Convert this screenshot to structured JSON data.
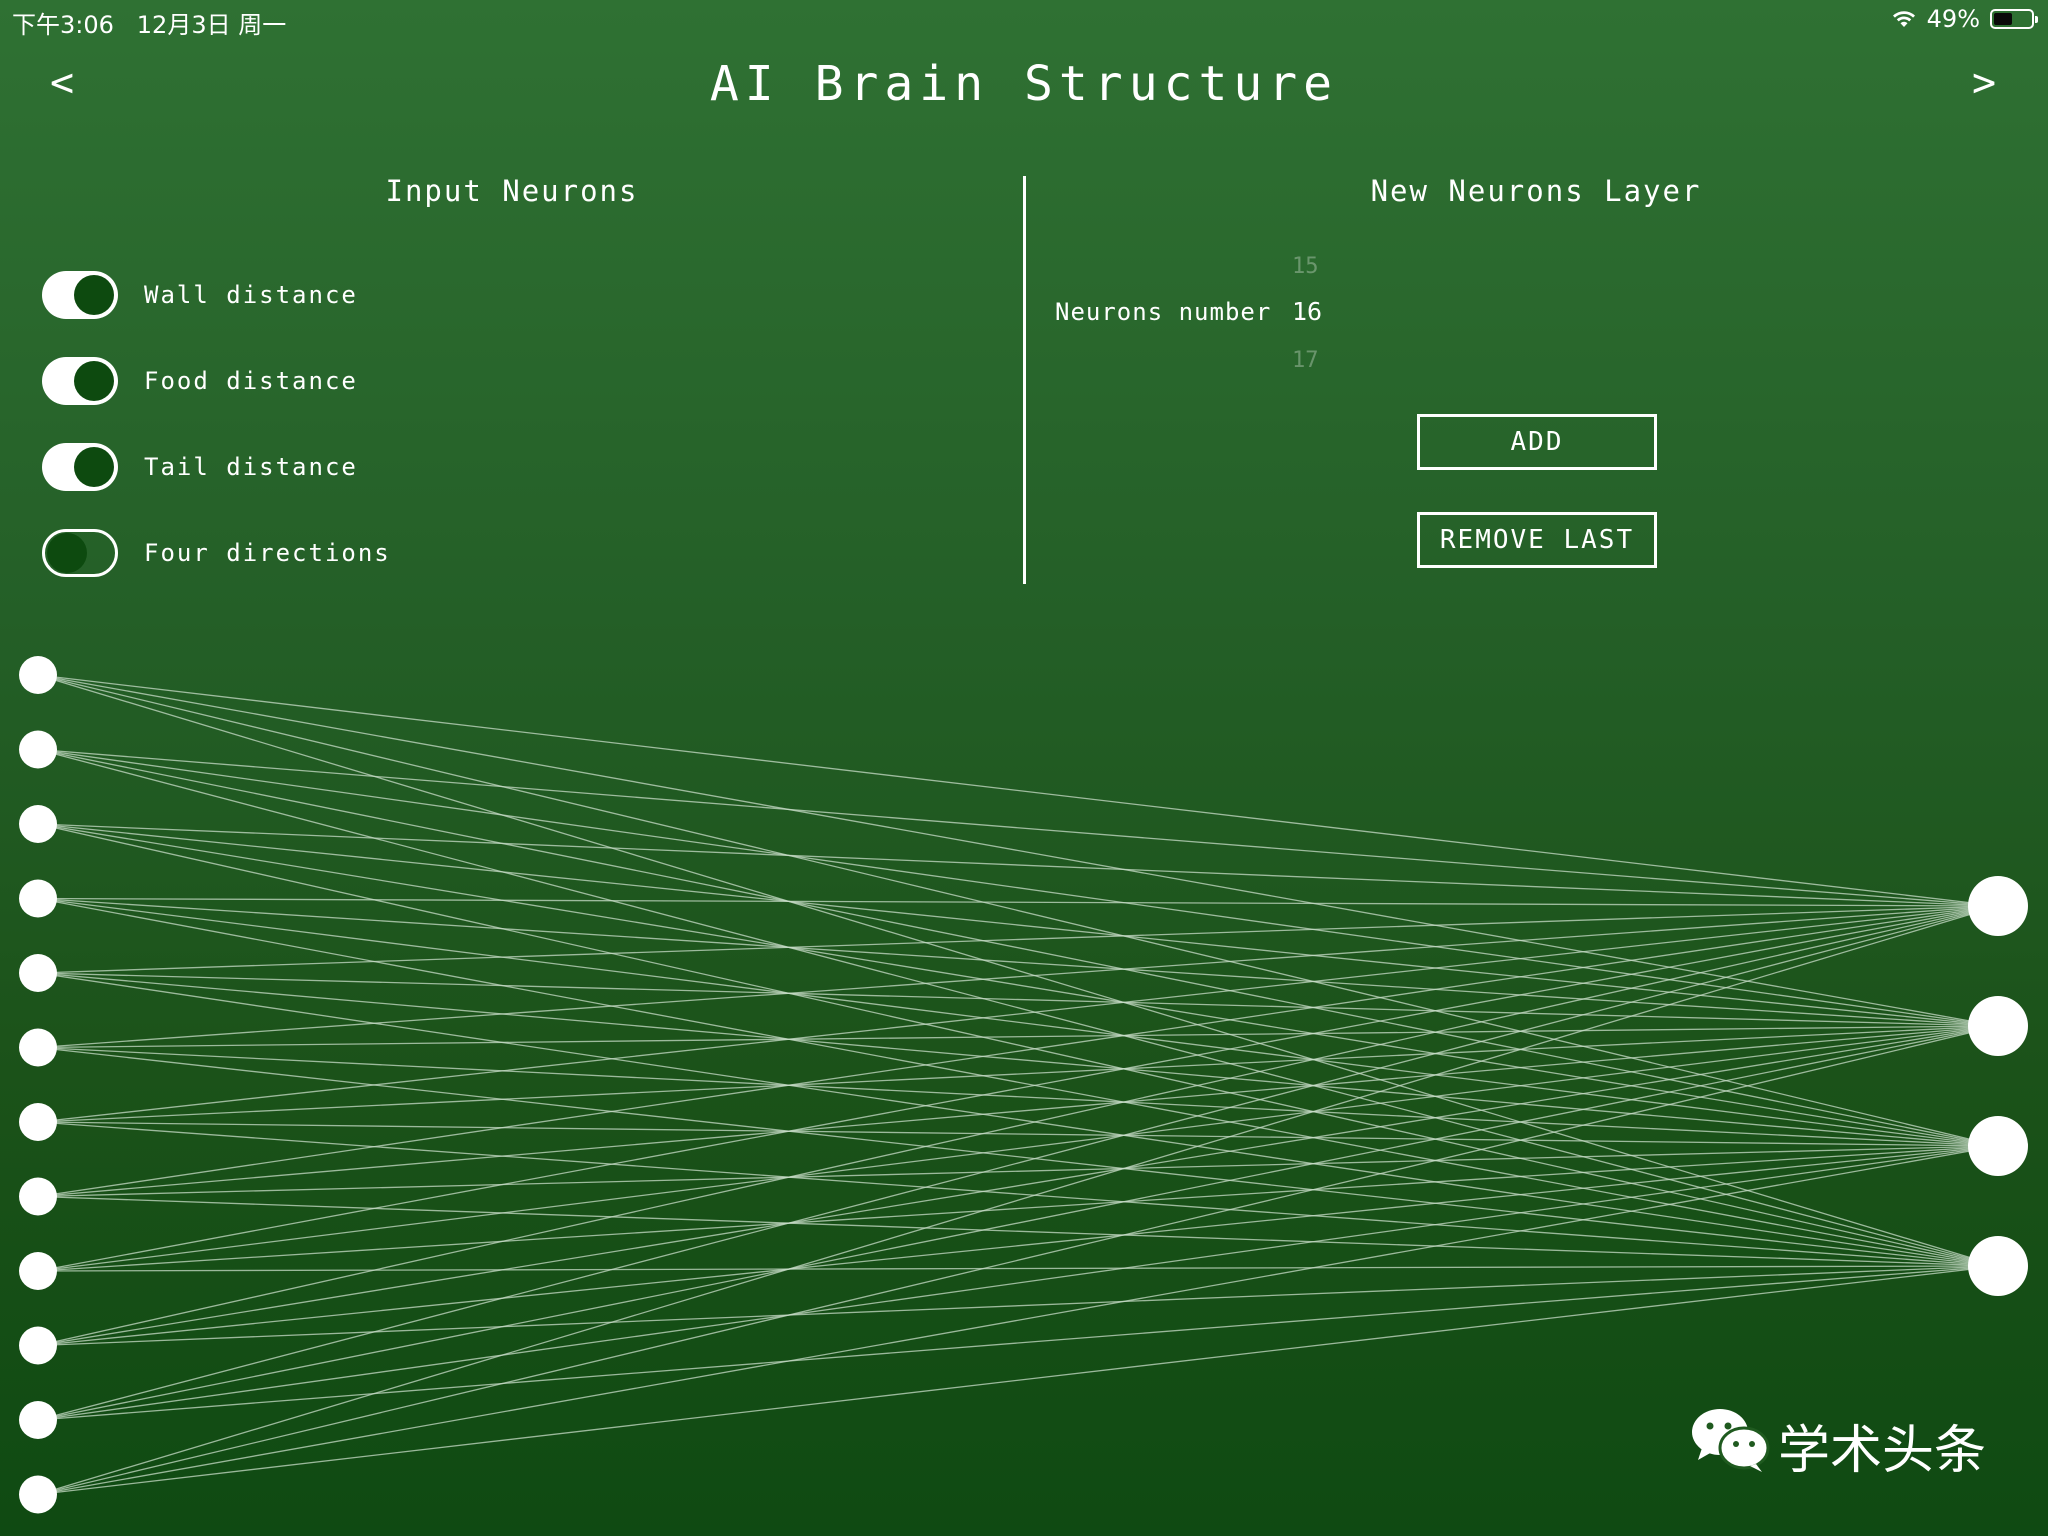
{
  "status_bar": {
    "time_date": "下午3:06   12月3日 周一",
    "battery_percent": "49%",
    "battery_level": 0.49,
    "icons": [
      "wifi-icon",
      "battery-icon"
    ]
  },
  "header": {
    "back_label": "<",
    "title": "AI Brain Structure",
    "forward_label": ">"
  },
  "input_neurons": {
    "title": "Input Neurons",
    "toggles": [
      {
        "label": "Wall distance",
        "on": true
      },
      {
        "label": "Food distance",
        "on": true
      },
      {
        "label": "Tail distance",
        "on": true
      },
      {
        "label": "Four directions",
        "on": false
      }
    ]
  },
  "new_layer": {
    "title": "New Neurons Layer",
    "picker_label": "Neurons number",
    "picker_prev": "15",
    "picker_selected": "16",
    "picker_next": "17",
    "add_label": "ADD",
    "remove_label": "REMOVE LAST"
  },
  "network": {
    "input_count": 12,
    "output_count": 4,
    "colors": {
      "node": "#ffffff",
      "edge": "#c8dcc8"
    }
  },
  "watermark": {
    "text": "学术头条",
    "icon": "wechat-icon"
  }
}
